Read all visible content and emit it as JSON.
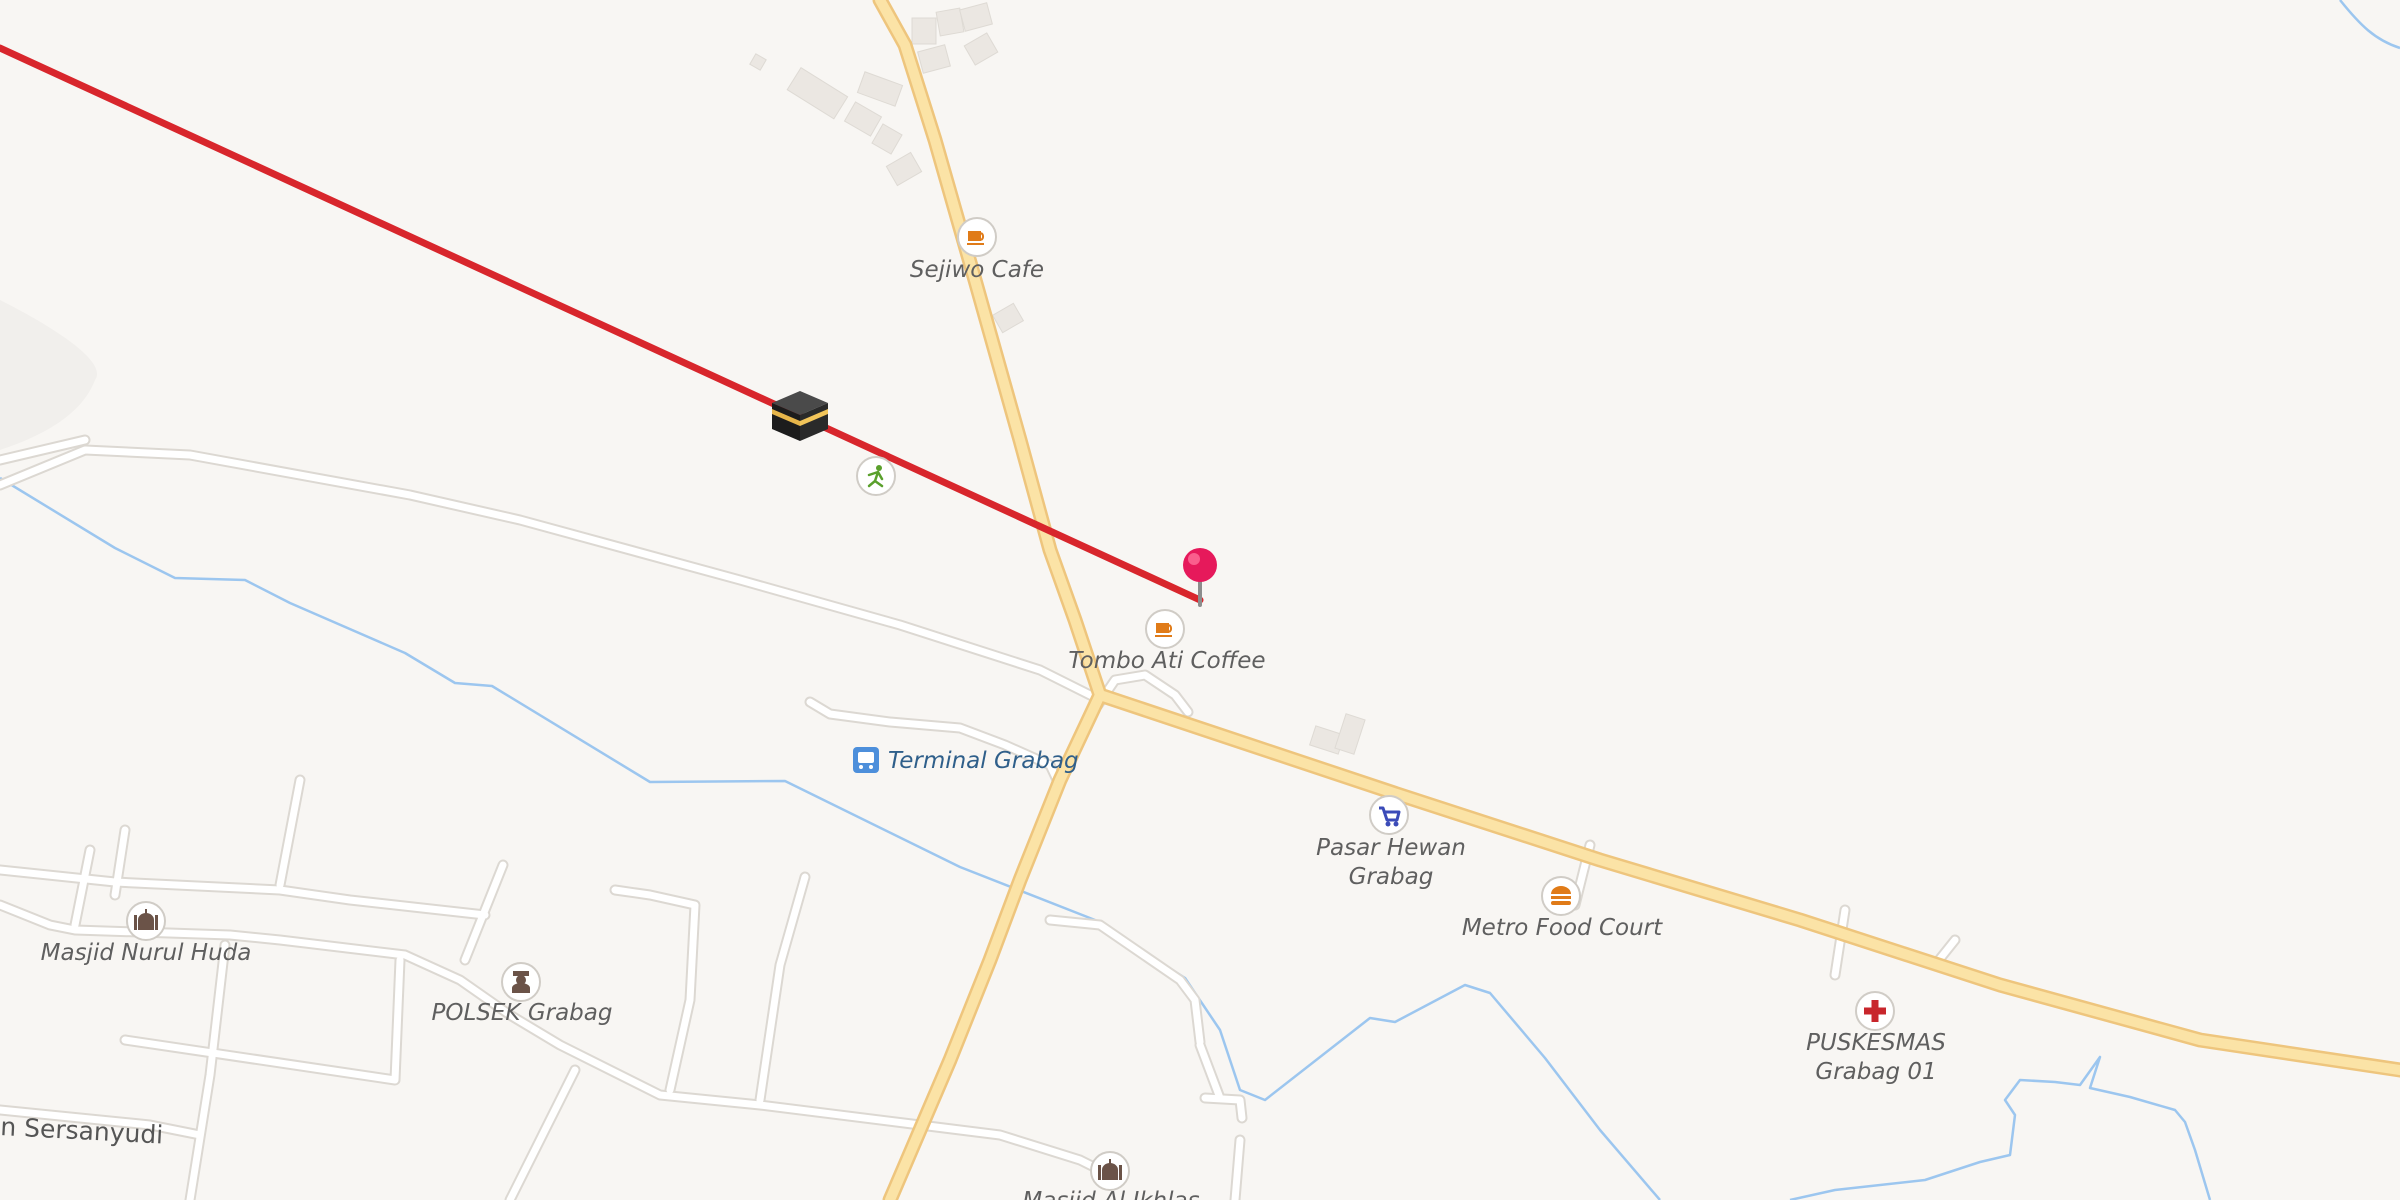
{
  "map": {
    "colors": {
      "background": "#f8f6f3",
      "main_road": "#fbe3a6",
      "main_road_edge": "#eec57d",
      "minor_road": "#ffffff",
      "minor_road_edge": "#dcd8d2",
      "waterway": "#9cc6ef",
      "qibla_line": "#d8262c",
      "pin": "#e6195b",
      "building": "#ebe7e2"
    },
    "markers": {
      "kaaba": {
        "icon": "kaaba-icon"
      },
      "pin": {
        "icon": "map-pin-icon"
      }
    },
    "pois": [
      {
        "id": "sejiwo-cafe",
        "icon": "coffee-cup-icon",
        "label": "Sejiwo Cafe"
      },
      {
        "id": "tombo-ati-coffee",
        "icon": "coffee-cup-icon",
        "label": "Tombo Ati Coffee"
      },
      {
        "id": "terminal-grabag",
        "icon": "bus-icon",
        "label": "Terminal Grabag"
      },
      {
        "id": "pasar-hewan-grabag",
        "icon": "shopping-cart-icon",
        "label_lines": [
          "Pasar Hewan",
          "Grabag"
        ]
      },
      {
        "id": "metro-food-court",
        "icon": "burger-icon",
        "label": "Metro Food Court"
      },
      {
        "id": "puskesmas-grabag-01",
        "icon": "medical-cross-icon",
        "label_lines": [
          "PUSKESMAS",
          "Grabag 01"
        ]
      },
      {
        "id": "masjid-nurul-huda",
        "icon": "mosque-icon",
        "label": "Masjid Nurul Huda"
      },
      {
        "id": "polsek-grabag",
        "icon": "police-icon",
        "label": "POLSEK Grabag"
      },
      {
        "id": "masjid-al-ikhlas",
        "icon": "mosque-icon",
        "label": "Masjid Al Ikhlas"
      },
      {
        "id": "sports",
        "icon": "running-person-icon"
      }
    ],
    "road_labels": [
      {
        "id": "sersanyudi",
        "label": "n Sersanyudi"
      }
    ]
  }
}
